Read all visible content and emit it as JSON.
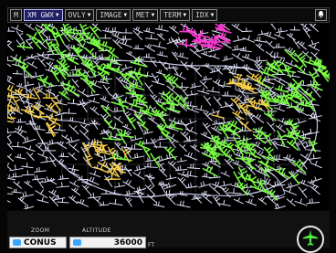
{
  "menu": {
    "items": [
      {
        "label": "M",
        "small": true
      },
      {
        "label": "XM GWX",
        "active": true
      },
      {
        "label": "OVLY"
      },
      {
        "label": "IMAGE"
      },
      {
        "label": "MET"
      },
      {
        "label": "TERM"
      },
      {
        "label": "IDX"
      }
    ]
  },
  "bottom": {
    "zoom_label": "ZOOM",
    "altitude_label": "ALTITUDE",
    "zoom_value": "CONUS",
    "altitude_value": "36000",
    "altitude_unit": "FT"
  },
  "colors": {
    "menu_active": "#202060",
    "map_white": "#d9d9ff",
    "wind_green": "#7cff46",
    "wind_yellow": "#ffd54a",
    "wind_magenta": "#ff3bd6"
  },
  "icons": {
    "menu_right_icon": "bell-icon",
    "bottom_right_icon": "airplane-icon"
  }
}
